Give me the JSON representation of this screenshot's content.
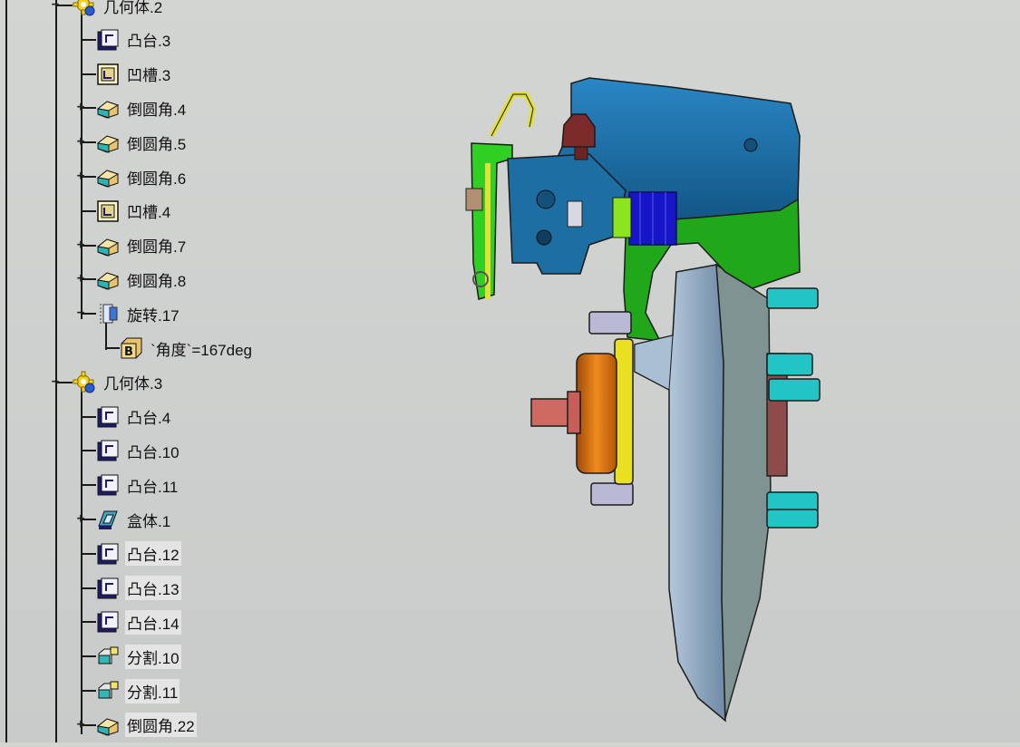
{
  "tree": {
    "nodes": [
      {
        "label": "几何体.2",
        "icon": "body-gear-icon",
        "toggle": "−",
        "level": 0
      },
      {
        "label": "凸台.3",
        "icon": "pad-icon",
        "toggle": "",
        "level": 1
      },
      {
        "label": "凹槽.3",
        "icon": "pocket-icon",
        "toggle": "",
        "level": 1
      },
      {
        "label": "倒圆角.4",
        "icon": "fillet-icon",
        "toggle": "+",
        "level": 1
      },
      {
        "label": "倒圆角.5",
        "icon": "fillet-icon",
        "toggle": "+",
        "level": 1
      },
      {
        "label": "倒圆角.6",
        "icon": "fillet-icon",
        "toggle": "+",
        "level": 1
      },
      {
        "label": "凹槽.4",
        "icon": "pocket-icon",
        "toggle": "",
        "level": 1
      },
      {
        "label": "倒圆角.7",
        "icon": "fillet-icon",
        "toggle": "+",
        "level": 1
      },
      {
        "label": "倒圆角.8",
        "icon": "fillet-icon",
        "toggle": "+",
        "level": 1
      },
      {
        "label": "旋转.17",
        "icon": "rotate-icon",
        "toggle": "−",
        "level": 1
      },
      {
        "label": "`角度`=167deg",
        "icon": "parameter-icon",
        "toggle": "",
        "level": 2
      },
      {
        "label": "几何体.3",
        "icon": "body-gear-icon",
        "toggle": "−",
        "level": 0
      },
      {
        "label": "凸台.4",
        "icon": "pad-icon",
        "toggle": "",
        "level": 1
      },
      {
        "label": "凸台.10",
        "icon": "pad-icon",
        "toggle": "",
        "level": 1
      },
      {
        "label": "凸台.11",
        "icon": "pad-icon",
        "toggle": "",
        "level": 1
      },
      {
        "label": "盒体.1",
        "icon": "shell-icon",
        "toggle": "+",
        "level": 1
      },
      {
        "label": "凸台.12",
        "icon": "pad-icon",
        "toggle": "",
        "level": 1,
        "hl": true
      },
      {
        "label": "凸台.13",
        "icon": "pad-icon",
        "toggle": "",
        "level": 1,
        "hl": true
      },
      {
        "label": "凸台.14",
        "icon": "pad-icon",
        "toggle": "",
        "level": 1,
        "hl": true
      },
      {
        "label": "分割.10",
        "icon": "split-icon",
        "toggle": "",
        "level": 1,
        "hl": true
      },
      {
        "label": "分割.11",
        "icon": "split-icon",
        "toggle": "",
        "level": 1,
        "hl": true
      },
      {
        "label": "倒圆角.22",
        "icon": "fillet-icon",
        "toggle": "+",
        "level": 1,
        "hl": true
      }
    ]
  },
  "colors": {
    "caliper": "#1b6fa8",
    "bracket": "#1fae17",
    "disc": "#9cb3c8",
    "hub_orange": "#e0760c",
    "stud_cyan": "#23c4c4",
    "bolt_lavender": "#b9b9d6",
    "spline_red": "#cf6a63",
    "clip_yellow": "#e2e036",
    "piston_blue": "#1616c8",
    "bleeder": "#7c2a2a"
  }
}
